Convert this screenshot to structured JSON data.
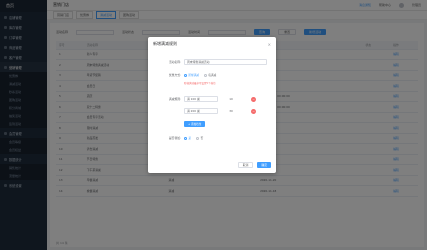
{
  "sidebar": {
    "logo": "首页",
    "items": [
      {
        "label": "店铺管理",
        "sub": false
      },
      {
        "label": "库存管理",
        "sub": false
      },
      {
        "label": "订单管理",
        "sub": false
      },
      {
        "label": "商品管理",
        "sub": false
      },
      {
        "label": "客户管理",
        "sub": false
      },
      {
        "label": "营销管理",
        "sub": false,
        "active": true
      },
      {
        "label": "优惠券",
        "sub": true
      },
      {
        "label": "满减活动",
        "sub": true
      },
      {
        "label": "秒杀活动",
        "sub": true
      },
      {
        "label": "团购活动",
        "sub": true
      },
      {
        "label": "积分商城",
        "sub": true
      },
      {
        "label": "抽奖活动",
        "sub": true
      },
      {
        "label": "签到活动",
        "sub": true
      },
      {
        "label": "会员管理",
        "sub": false
      },
      {
        "label": "会员等级",
        "sub": true
      },
      {
        "label": "会员权益",
        "sub": true
      },
      {
        "label": "数据统计",
        "sub": false
      },
      {
        "label": "销售统计",
        "sub": true
      },
      {
        "label": "流量统计",
        "sub": true
      },
      {
        "label": "系统设置",
        "sub": false
      }
    ]
  },
  "topbar": {
    "title": "营销门店",
    "links": [
      "消息通知",
      "帮助中心"
    ],
    "user": "管理员"
  },
  "tabs": [
    "营销门店",
    "优惠券",
    "满减活动",
    "团购活动"
  ],
  "filters": {
    "label1": "活动名称",
    "label2": "活动状态",
    "label3": "活动时间",
    "search": "查询",
    "reset": "重置",
    "add": "新增活动"
  },
  "table": {
    "columns": [
      "序号",
      "活动名称",
      "活动类型",
      "活动时间",
      "创建时间",
      "状态",
      "操作"
    ],
    "rows": [
      [
        "1",
        "新人专享",
        "满减",
        "",
        "2021-01-05",
        "",
        "编辑"
      ],
      [
        "2",
        "周末特惠满减活动",
        "满减",
        "",
        "2021-01-04",
        "",
        "编辑"
      ],
      [
        "3",
        "年货节促销",
        "满减",
        "",
        "2021-01-03",
        "",
        "编辑"
      ],
      [
        "4",
        "会员日",
        "满减",
        "",
        "2021-01-02",
        "",
        "编辑"
      ],
      [
        "5",
        "店庆",
        "满减",
        "",
        "2021-01-01 00:00:00",
        "",
        "编辑"
      ],
      [
        "6",
        "双十二特惠",
        "满减",
        "",
        "2020-12-12 00:00:00",
        "",
        "编辑"
      ],
      [
        "7",
        "会员专享活动",
        "满减",
        "",
        "2020-12-10",
        "",
        "编辑"
      ],
      [
        "8",
        "限时满减",
        "满减",
        "",
        "2020-12-08",
        "",
        "编辑"
      ],
      [
        "9",
        "新品首发",
        "满减",
        "",
        "2020-12-05",
        "",
        "编辑"
      ],
      [
        "10",
        "清仓满减",
        "满减",
        "",
        "2020-12-01",
        "",
        "编辑"
      ],
      [
        "11",
        "节日特惠",
        "满减",
        "",
        "2020-11-28",
        "",
        "编辑"
      ],
      [
        "12",
        "下午茶满减",
        "满减",
        "",
        "2020-11-25",
        "",
        "编辑"
      ],
      [
        "13",
        "早餐满减",
        "满减",
        "",
        "2020-11-20",
        "",
        "编辑"
      ],
      [
        "14",
        "晚餐满减",
        "满减",
        "",
        "2020-11-18",
        "",
        "编辑"
      ]
    ]
  },
  "pagination": "共 14 条",
  "dialog": {
    "title": "新增满减规则",
    "close": "×",
    "name_label": "活动名称:",
    "name_value": "周末特惠满减活动",
    "type_label": "优惠方式:",
    "type_opt1": "阶梯满减",
    "type_opt2": "每满减",
    "warn": "阶梯满减最多可设置5个档位",
    "rules_label": "满减规则:",
    "rule1": "满 100 减",
    "rule1_num": "10",
    "rule2": "满 200 减",
    "rule2_num": "30",
    "add_rule": "+ 添加档位",
    "stack_label": "是否叠加:",
    "stack_opt1": "是",
    "stack_opt2": "否",
    "cancel": "取消",
    "confirm": "确定"
  },
  "colors": {
    "primary": "#409eff",
    "danger": "#f56c6c",
    "sidebar": "#1f2d3d"
  }
}
